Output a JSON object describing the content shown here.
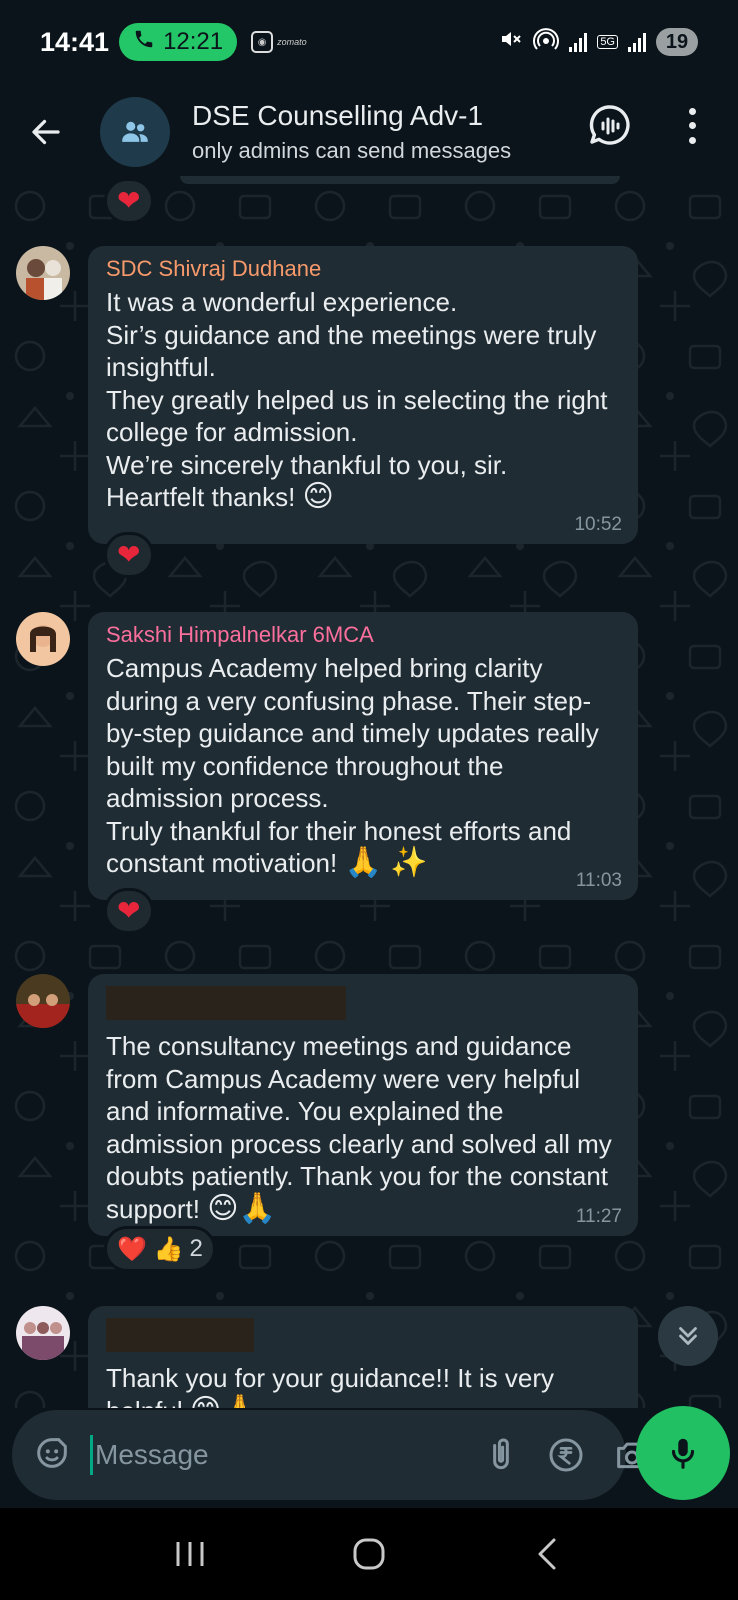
{
  "status_bar": {
    "time": "14:41",
    "call_duration": "12:21",
    "app_label": "zomato",
    "network": "5G",
    "battery": "19"
  },
  "header": {
    "title": "DSE Counselling Adv-1",
    "subtitle": "only admins can send messages"
  },
  "messages": [
    {
      "sender": "SDC Shivraj Dudhane",
      "sender_color": "#f79a6b",
      "text": "It was a wonderful experience.\nSir’s guidance and the meetings were truly insightful.\nThey greatly helped us in selecting the right college for admission.\nWe’re sincerely thankful to you, sir.\nHeartfelt thanks!",
      "emoji": "😊",
      "time": "10:52",
      "reaction": "❤️"
    },
    {
      "sender": "Sakshi Himpalnelkar 6MCA",
      "sender_color": "#fb6f9c",
      "text": "Campus Academy helped bring clarity during a very confusing phase. Their step-by-step guidance and timely updates really built my confidence throughout the admission process.\nTruly thankful for their honest efforts and constant motivation!",
      "emoji": "🙏 ✨",
      "time": "11:03",
      "reaction": "❤️"
    },
    {
      "sender": "",
      "text": "The consultancy meetings and guidance from Campus Academy were very helpful and informative. You explained the admission process clearly and solved all my doubts patiently. Thank you for the constant support!",
      "emoji": "😊🙏",
      "time": "11:27",
      "reaction": "❤️ 👍",
      "reaction_count": "2"
    },
    {
      "sender": "",
      "text": "Thank you for your guidance!! It is very helpful",
      "emoji": "😊🙏"
    }
  ],
  "input": {
    "placeholder": "Message"
  },
  "colors": {
    "accent": "#21c063",
    "bubble": "#202c33",
    "background": "#0b141a",
    "heart": "#e8263b"
  }
}
